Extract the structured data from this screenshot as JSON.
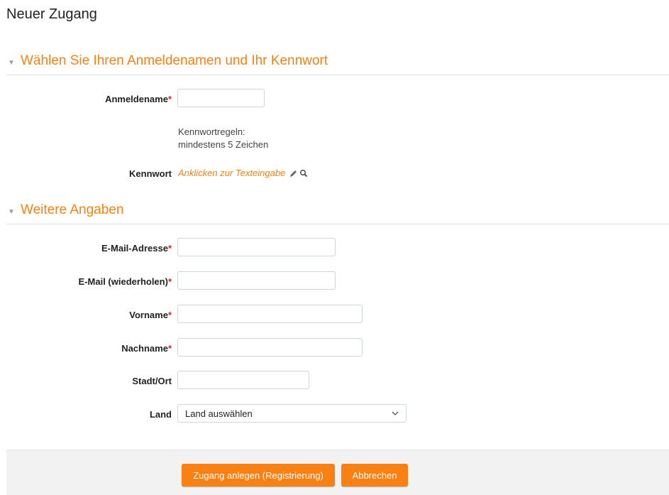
{
  "page": {
    "title": "Neuer Zugang"
  },
  "section1": {
    "title": "Wählen Sie Ihren Anmeldenamen und Ihr Kennwort",
    "username_label": "Anmeldename",
    "password_rules_line1": "Kennwortregeln:",
    "password_rules_line2": "mindestens 5 Zeichen",
    "password_label": "Kennwort",
    "password_link": "Anklicken zur Texteingabe"
  },
  "section2": {
    "title": "Weitere Angaben",
    "email_label": "E-Mail-Adresse",
    "email2_label": "E-Mail (wiederholen)",
    "firstname_label": "Vorname",
    "lastname_label": "Nachname",
    "city_label": "Stadt/Ort",
    "country_label": "Land",
    "country_value": "Land auswählen"
  },
  "required_marker": "*",
  "buttons": {
    "submit": "Zugang anlegen (Registrierung)",
    "cancel": "Abbrechen"
  },
  "colors": {
    "accent": "#f98012",
    "required": "#c9302c"
  }
}
